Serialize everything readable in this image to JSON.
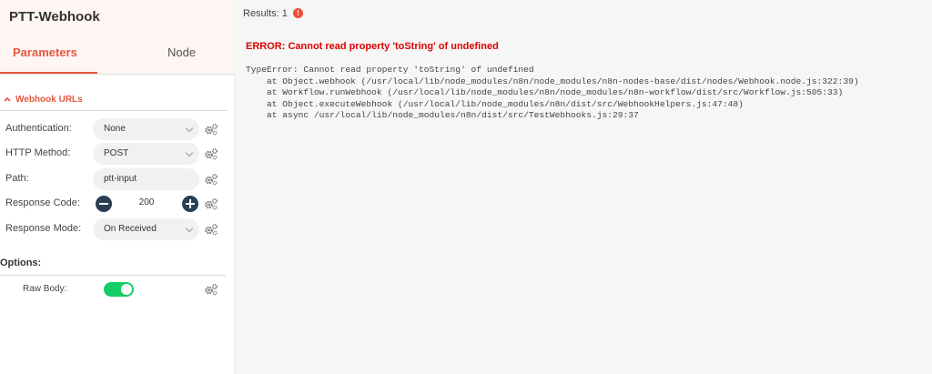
{
  "node": {
    "title": "PTT-Webhook"
  },
  "tabs": {
    "parameters": "Parameters",
    "node": "Node"
  },
  "webhook_urls": {
    "label": "Webhook URLs"
  },
  "params": {
    "authentication": {
      "label": "Authentication:",
      "value": "None"
    },
    "http_method": {
      "label": "HTTP Method:",
      "value": "POST"
    },
    "path": {
      "label": "Path:",
      "value": "ptt-input"
    },
    "response_code": {
      "label": "Response Code:",
      "value": "200"
    },
    "response_mode": {
      "label": "Response Mode:",
      "value": "On Received"
    }
  },
  "options": {
    "label": "Options:",
    "raw_body": {
      "label": "Raw Body:",
      "enabled": true
    }
  },
  "results": {
    "label": "Results: 1",
    "badge": "!"
  },
  "error": {
    "title": "ERROR: Cannot read property 'toString' of undefined",
    "stack": "TypeError: Cannot read property 'toString' of undefined\n    at Object.webhook (/usr/local/lib/node_modules/n8n/node_modules/n8n-nodes-base/dist/nodes/Webhook.node.js:322:39)\n    at Workflow.runWebhook (/usr/local/lib/node_modules/n8n/node_modules/n8n-workflow/dist/src/Workflow.js:505:33)\n    at Object.executeWebhook (/usr/local/lib/node_modules/n8n/dist/src/WebhookHelpers.js:47:48)\n    at async /usr/local/lib/node_modules/n8n/dist/src/TestWebhooks.js:29:37"
  },
  "colors": {
    "accent": "#e5573f",
    "error": "#e00000",
    "toggle_on": "#13ce66",
    "stepper": "#2a3e52",
    "header_bg": "#fff5f2"
  },
  "icons": {
    "gears": "gears-icon",
    "minus": "minus-icon",
    "plus": "plus-icon",
    "chevron_up": "chevron-up-icon",
    "chevron_down": "chevron-down-icon",
    "info": "info-icon"
  }
}
